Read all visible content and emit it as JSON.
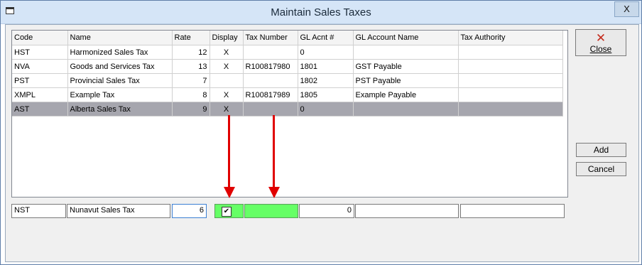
{
  "window": {
    "title": "Maintain Sales Taxes",
    "close_glyph": "X"
  },
  "table": {
    "columns": [
      "Code",
      "Name",
      "Rate",
      "Display",
      "Tax Number",
      "GL Acnt #",
      "GL Account Name",
      "Tax Authority"
    ],
    "rows": [
      [
        "HST",
        "Harmonized Sales Tax",
        "12",
        "X",
        "",
        "0",
        "",
        ""
      ],
      [
        "NVA",
        "Goods and Services Tax",
        "13",
        "X",
        "R100817980",
        "1801",
        "GST Payable",
        ""
      ],
      [
        "PST",
        "Provincial Sales Tax",
        "7",
        "",
        "",
        "1802",
        "PST Payable",
        ""
      ],
      [
        "XMPL",
        "Example Tax",
        "8",
        "X",
        "R100817989",
        "1805",
        "Example Payable",
        ""
      ],
      [
        "AST",
        "Alberta Sales Tax",
        "9",
        "X",
        "",
        "0",
        "",
        ""
      ]
    ],
    "selected_row": 4
  },
  "buttons": {
    "close": "Close",
    "add": "Add",
    "cancel": "Cancel"
  },
  "entry": {
    "code": "NST",
    "name": "Nunavut Sales Tax",
    "rate": "6",
    "display_checked": true,
    "check_glyph": "✔",
    "tax_number": "",
    "gl_acnt": "0",
    "gl_account_name": "",
    "tax_authority": ""
  },
  "colors": {
    "highlight_green": "#66ff66",
    "arrow_red": "#e00000",
    "selected_row": "#a6a6ae"
  }
}
